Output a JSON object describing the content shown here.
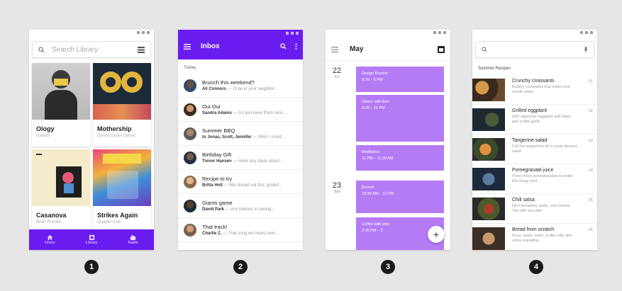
{
  "screen1": {
    "search_placeholder": "Search Library",
    "albums": [
      {
        "title": "Ology",
        "artist": "Gallant"
      },
      {
        "title": "Mothership",
        "artist": "Dance Gavin Dance"
      },
      {
        "title": "Casanova",
        "artist": "Brian Procter"
      },
      {
        "title": "Strikes Again",
        "artist": "Quarter Cab"
      }
    ],
    "nav": [
      {
        "label": "Home"
      },
      {
        "label": "Library"
      },
      {
        "label": "Radio"
      }
    ],
    "accent": "#6a1cf0"
  },
  "screen2": {
    "title": "Inbox",
    "section": "Today",
    "mails": [
      {
        "subject": "Brunch this weekend?",
        "from": "Ali Connors",
        "snippet": "— I'll be in your neighbor..."
      },
      {
        "subject": "Oui Oui",
        "from": "Sandra Adams",
        "snippet": "— Do you have Paris reco..."
      },
      {
        "subject": "Summer BBQ",
        "from": "to Jonas, Scott, Jennifer",
        "snippet": "— Wish I could..."
      },
      {
        "subject": "Birthday Gift",
        "from": "Trevor Hansen",
        "snippet": "— Have any ideas about..."
      },
      {
        "subject": "Recipe to try",
        "from": "Britta Holt",
        "snippet": "— We should eat this: grated..."
      },
      {
        "subject": "Giants game",
        "from": "David Park",
        "snippet": "— Any interest in seeing..."
      },
      {
        "subject": "That track!",
        "from": "Charlie Z.",
        "snippet": "— That song we heard over..."
      }
    ]
  },
  "screen3": {
    "title": "May",
    "days": [
      {
        "date": "22",
        "weekday": "Fri"
      },
      {
        "date": "23",
        "weekday": "Sat"
      }
    ],
    "events": [
      {
        "title": "Design Review",
        "time": "5:30 – 5 PM"
      },
      {
        "title": "Dinner with Ben",
        "time": "6:30 – 10 PM"
      },
      {
        "title": "Meditation",
        "time": "11 PM – 11:30 AM"
      },
      {
        "title": "Brunch",
        "time": "10:30 AM – 12 PM"
      },
      {
        "title": "Coffee with amy",
        "time": "2:30 PM – 3"
      }
    ],
    "fab_label": "+"
  },
  "screen4": {
    "section": "Summer Recipes",
    "recipes": [
      {
        "title": "Crunchy croissants",
        "desc": "Buttery croissants that make your mouth water",
        "num": "01"
      },
      {
        "title": "Grilled eggplant",
        "desc": "Grill Japanese eggplant with basil and a little garlic",
        "num": "02"
      },
      {
        "title": "Tangerine salad",
        "desc": "Cut the tangerines for a zesty dessert salad",
        "num": "03"
      },
      {
        "title": "Pomegranate juice",
        "desc": "Press fresh pomegranates to make this tangy juice",
        "num": "04"
      },
      {
        "title": "Chili salsa",
        "desc": "Dice tomatoes, garlic, and onions. Top with avocado",
        "num": "05"
      },
      {
        "title": "Bread from scratch",
        "desc": "Flour, yeast, water, a little salt, and some kneading",
        "num": "06"
      }
    ]
  },
  "badges": [
    "1",
    "2",
    "3",
    "4"
  ]
}
